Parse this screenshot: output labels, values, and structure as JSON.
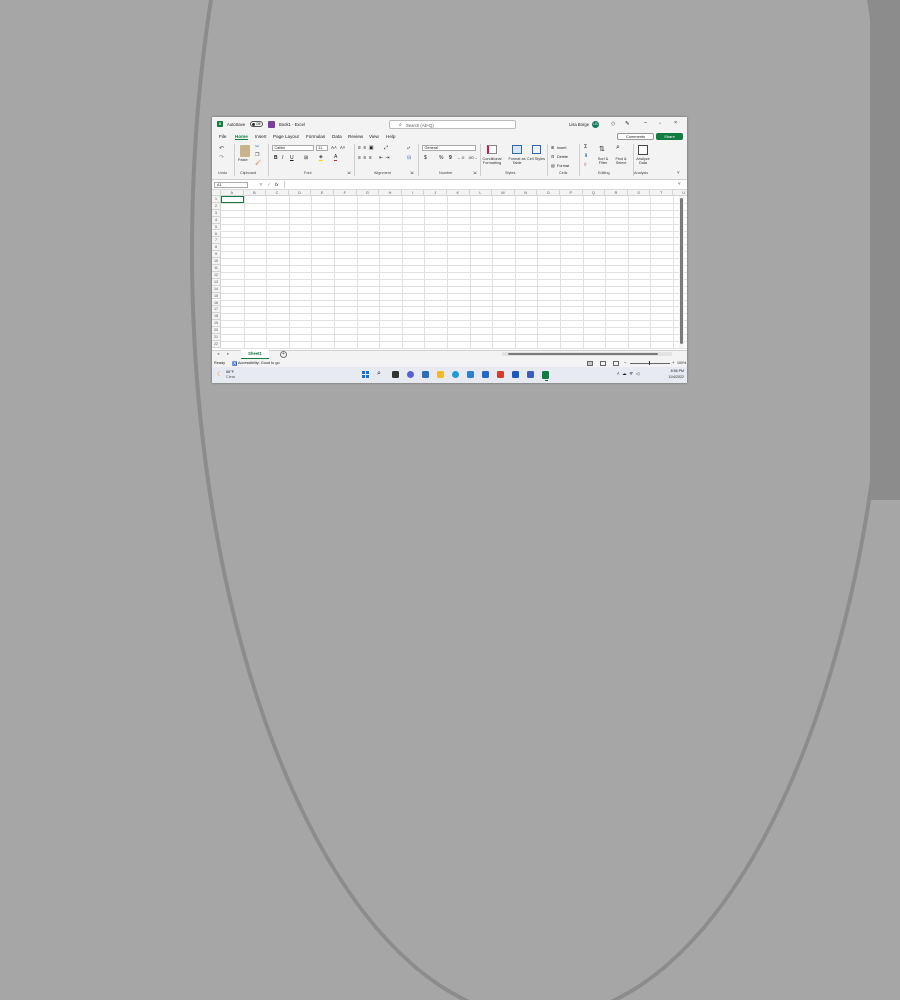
{
  "titlebar": {
    "autosave_label": "AutoSave",
    "autosave_state": "Off",
    "doc_title": "Book1 - Excel",
    "search_placeholder": "Search (Alt+Q)",
    "user_name": "Lisa Borge",
    "user_initials": "LB"
  },
  "menu": {
    "tabs": [
      "File",
      "Home",
      "Insert",
      "Page Layout",
      "Formulas",
      "Data",
      "Review",
      "View",
      "Help"
    ],
    "active": "Home",
    "comments_label": "Comments",
    "share_label": "Share"
  },
  "ribbon": {
    "groups": [
      "Undo",
      "Clipboard",
      "Font",
      "Alignment",
      "Number",
      "Styles",
      "Cells",
      "Editing",
      "Analysis"
    ],
    "paste_label": "Paste",
    "font_name": "Calibri",
    "font_size": "11",
    "number_format": "General",
    "conditional_formatting": "Conditional Formatting",
    "format_as_table": "Format as Table",
    "cell_styles": "Cell Styles",
    "insert_label": "Insert",
    "delete_label": "Delete",
    "format_label": "Format",
    "sort_filter": "Sort & Filter",
    "find_select": "Find & Select",
    "analyze_data": "Analyze Data",
    "bold": "B",
    "italic": "I",
    "underline": "U",
    "currency": "$",
    "percent": "%",
    "comma": "9"
  },
  "formula_bar": {
    "name_box": "A1",
    "fx": "fx",
    "value": ""
  },
  "grid": {
    "columns": [
      "A",
      "B",
      "C",
      "D",
      "E",
      "F",
      "G",
      "H",
      "I",
      "J",
      "K",
      "L",
      "M",
      "N",
      "O",
      "P",
      "Q",
      "R",
      "S",
      "T",
      "U"
    ],
    "rows": [
      "1",
      "2",
      "3",
      "4",
      "5",
      "6",
      "7",
      "8",
      "9",
      "10",
      "11",
      "12",
      "13",
      "14",
      "15",
      "16",
      "17",
      "18",
      "19",
      "20",
      "21",
      "22"
    ],
    "selected_cell": "A1"
  },
  "sheets": {
    "tabs": [
      "Sheet1"
    ],
    "add_label": "+"
  },
  "status": {
    "ready": "Ready",
    "accessibility": "Accessibility: Good to go",
    "zoom": "100%"
  },
  "taskbar": {
    "weather_temp": "66°F",
    "weather_desc": "Clear",
    "time": "8:56 PM",
    "date": "11/4/2022"
  },
  "colors": {
    "accent": "#107c41",
    "chrome": "#f3f3f3"
  }
}
